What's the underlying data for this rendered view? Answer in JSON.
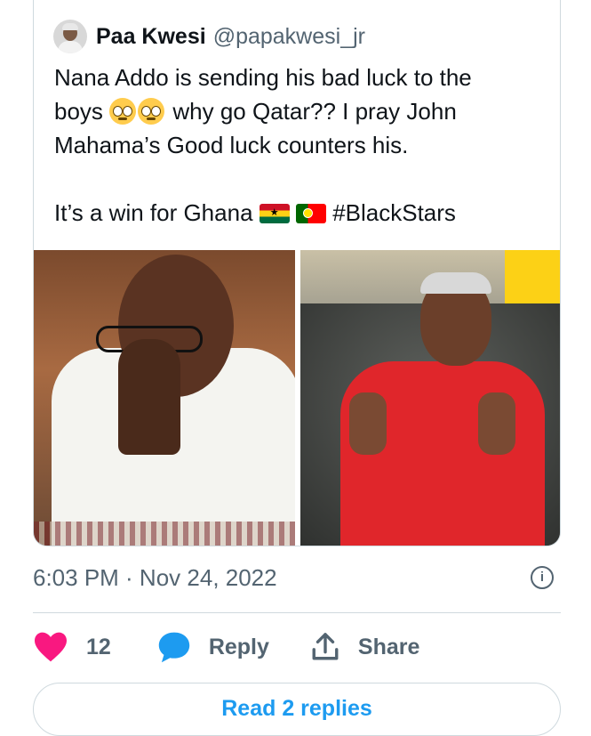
{
  "quoted_tweet": {
    "display_name": "Paa Kwesi",
    "handle": "@papakwesi_jr",
    "text_line1": "Nana Addo is sending his bad luck to the",
    "text_line2_a": "boys ",
    "text_line2_b": " why go Qatar?? I pray John",
    "text_line3": "Mahama’s Good luck counters his.",
    "text_line5_a": "It’s a win for Ghana ",
    "text_line5_b": " #BlackStars",
    "emoji": [
      "pleading-face",
      "pleading-face"
    ],
    "flags": [
      "ghana-flag",
      "portugal-flag"
    ]
  },
  "timestamp": "6:03 PM · Nov 24, 2022",
  "actions": {
    "like_count": "12",
    "reply_label": "Reply",
    "share_label": "Share"
  },
  "read_replies": "Read 2 replies",
  "colors": {
    "like": "#f91880",
    "reply": "#1d9bf0",
    "link": "#1d9bf0",
    "muted": "#536471",
    "border": "#cfd9de"
  }
}
